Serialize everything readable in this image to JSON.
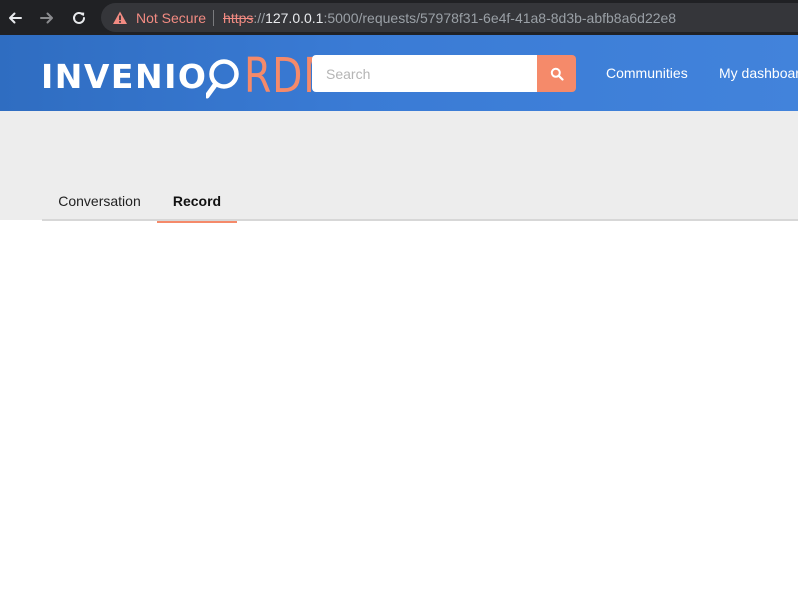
{
  "browser": {
    "security_label": "Not Secure",
    "url_scheme": "https",
    "url_separator": "://",
    "url_host": "127.0.0.1",
    "url_path": ":5000/requests/57978f31-6e4f-41a8-8d3b-abfb8a6d22e8"
  },
  "header": {
    "logo_primary": "INVENIO",
    "logo_secondary": "RDM",
    "search_placeholder": "Search",
    "nav": {
      "communities": "Communities",
      "dashboard": "My dashboard"
    }
  },
  "tabs": [
    {
      "label": "Conversation",
      "active": false
    },
    {
      "label": "Record",
      "active": true
    }
  ],
  "colors": {
    "header_blue": "#3a7bd5",
    "accent_orange": "#f58a6a",
    "band_grey": "#ededed",
    "insecure_red": "#f28b82"
  }
}
